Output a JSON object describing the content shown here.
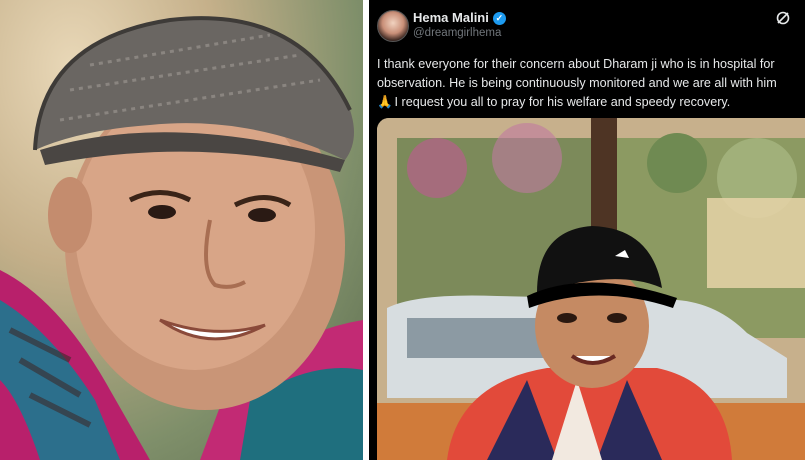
{
  "tweet": {
    "display_name": "Hema Malini",
    "handle": "@dreamgirlhema",
    "text_lines": [
      "I thank everyone for their concern about Dharam ji who is in hospital for",
      "observation. He is being continuously monitored and we are all with him",
      "I request you all to pray for his welfare and speedy recovery."
    ],
    "emoji": "🙏"
  },
  "icons": {
    "verified": "verified-badge-icon",
    "grok": "grok-icon",
    "prayer": "folded-hands-icon"
  },
  "colors": {
    "tweet_background": "#000000",
    "text": "#e7e9ea",
    "handle": "#71767b",
    "verified": "#1d9bf0"
  }
}
